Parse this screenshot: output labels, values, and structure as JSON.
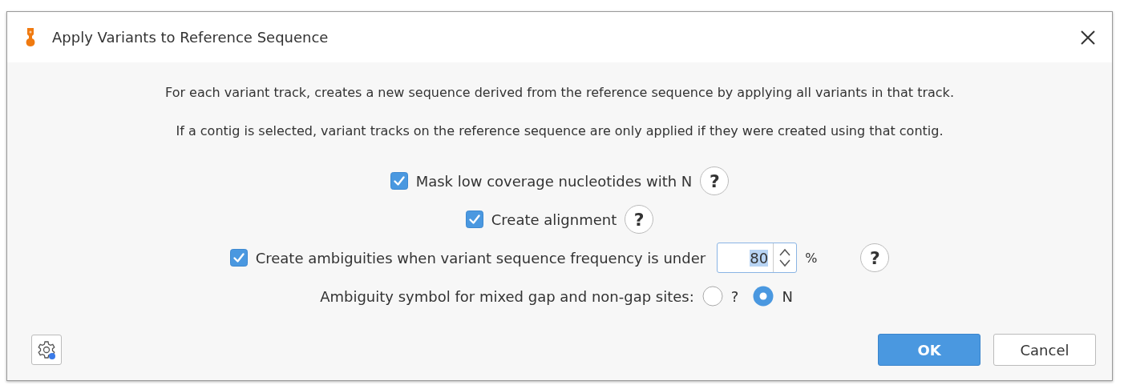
{
  "window": {
    "title": "Apply Variants to Reference Sequence"
  },
  "description": [
    "For each variant track, creates a new sequence derived from the reference sequence by applying all variants in that track.",
    "If a contig is selected, variant tracks on the reference sequence are only applied if they were created using that contig."
  ],
  "options": [
    {
      "kind": "checkbox",
      "label": "Mask low coverage nucleotides with N",
      "checked": true,
      "help": "?"
    },
    {
      "kind": "checkbox",
      "label": "Create alignment",
      "checked": true,
      "help": "?"
    },
    {
      "kind": "number",
      "label": "Create ambiguities when variant sequence frequency is under",
      "checked": true,
      "value": "80",
      "unit": "%",
      "help": "?"
    },
    {
      "kind": "radio",
      "label": "Ambiguity symbol for mixed gap and non-gap sites:",
      "choices": [
        {
          "label": "?",
          "selected": false
        },
        {
          "label": "N",
          "selected": true
        }
      ]
    }
  ],
  "buttons": [
    {
      "label": "OK",
      "kind": "primary"
    },
    {
      "label": "Cancel",
      "kind": "secondary"
    }
  ]
}
